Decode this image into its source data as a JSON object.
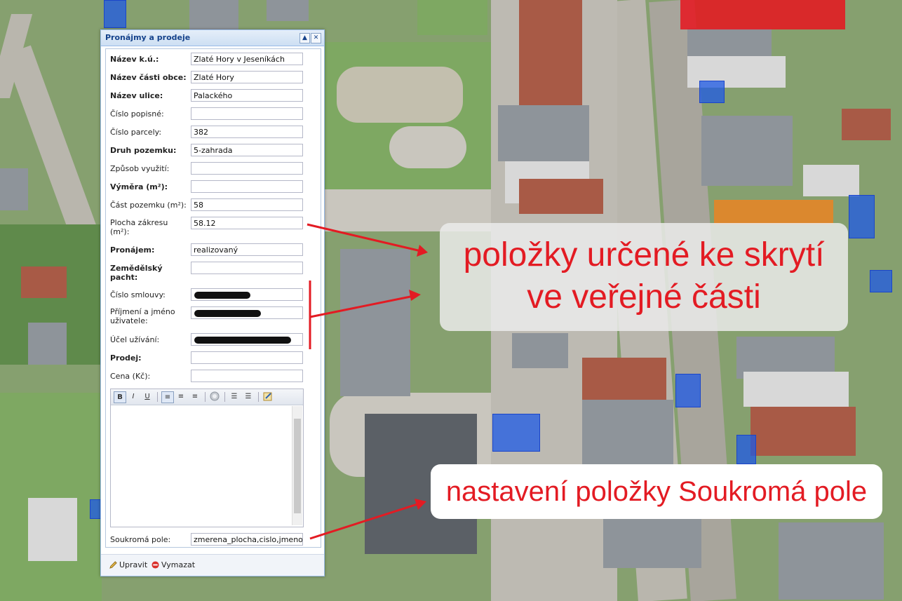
{
  "window": {
    "title": "Pronájmy a prodeje",
    "collapse_icon": "chevron-up-icon",
    "close_icon": "close-icon"
  },
  "form": {
    "fields": [
      {
        "label": "Název k.ú.:",
        "bold": true,
        "value": "Zlaté Hory v Jeseníkách"
      },
      {
        "label": "Název části obce:",
        "bold": true,
        "value": "Zlaté Hory"
      },
      {
        "label": "Název ulice:",
        "bold": true,
        "value": "Palackého"
      },
      {
        "label": "Číslo popisné:",
        "bold": false,
        "value": ""
      },
      {
        "label": "Číslo parcely:",
        "bold": false,
        "value": "382"
      },
      {
        "label": "Druh pozemku:",
        "bold": true,
        "value": "5-zahrada"
      },
      {
        "label": "Způsob využití:",
        "bold": false,
        "value": ""
      },
      {
        "label": "Výměra (m²):",
        "bold": true,
        "value": ""
      },
      {
        "label": "Část pozemku (m²):",
        "bold": false,
        "value": "58"
      },
      {
        "label": "Plocha zákresu (m²):",
        "bold": false,
        "value": "58.12"
      },
      {
        "label": "Pronájem:",
        "bold": true,
        "value": "realizovaný"
      },
      {
        "label": "Zemědělský pacht:",
        "bold": true,
        "value": ""
      },
      {
        "label": "Číslo smlouvy:",
        "bold": false,
        "value": "",
        "redacted": true
      },
      {
        "label": "Příjmení a jméno uživatele:",
        "bold": false,
        "value": "",
        "redacted": true
      },
      {
        "label": "Účel užívání:",
        "bold": false,
        "value": "",
        "redacted": true
      },
      {
        "label": "Prodej:",
        "bold": true,
        "value": ""
      },
      {
        "label": "Cena (Kč):",
        "bold": false,
        "value": ""
      }
    ],
    "editor_toolbar": {
      "bold": "B",
      "italic": "I",
      "underline": "U",
      "icons": [
        "bold-icon",
        "italic-icon",
        "underline-icon",
        "align-left-icon",
        "align-center-icon",
        "align-right-icon",
        "link-icon",
        "ordered-list-icon",
        "unordered-list-icon",
        "source-edit-icon"
      ]
    },
    "private_fields": {
      "label": "Soukromá pole:",
      "value": "zmerena_plocha,cislo,jmeno_"
    }
  },
  "footer": {
    "edit_label": "Upravit",
    "delete_label": "Vymazat"
  },
  "annotations": {
    "callout_hide_line1": "položky určené ke skrytí",
    "callout_hide_line2": "ve veřejné části",
    "callout_private": "nastavení položky Soukromá pole"
  },
  "colors": {
    "callout_text": "#e31b23",
    "window_border": "#99bbe8",
    "title_text": "#15428b"
  }
}
